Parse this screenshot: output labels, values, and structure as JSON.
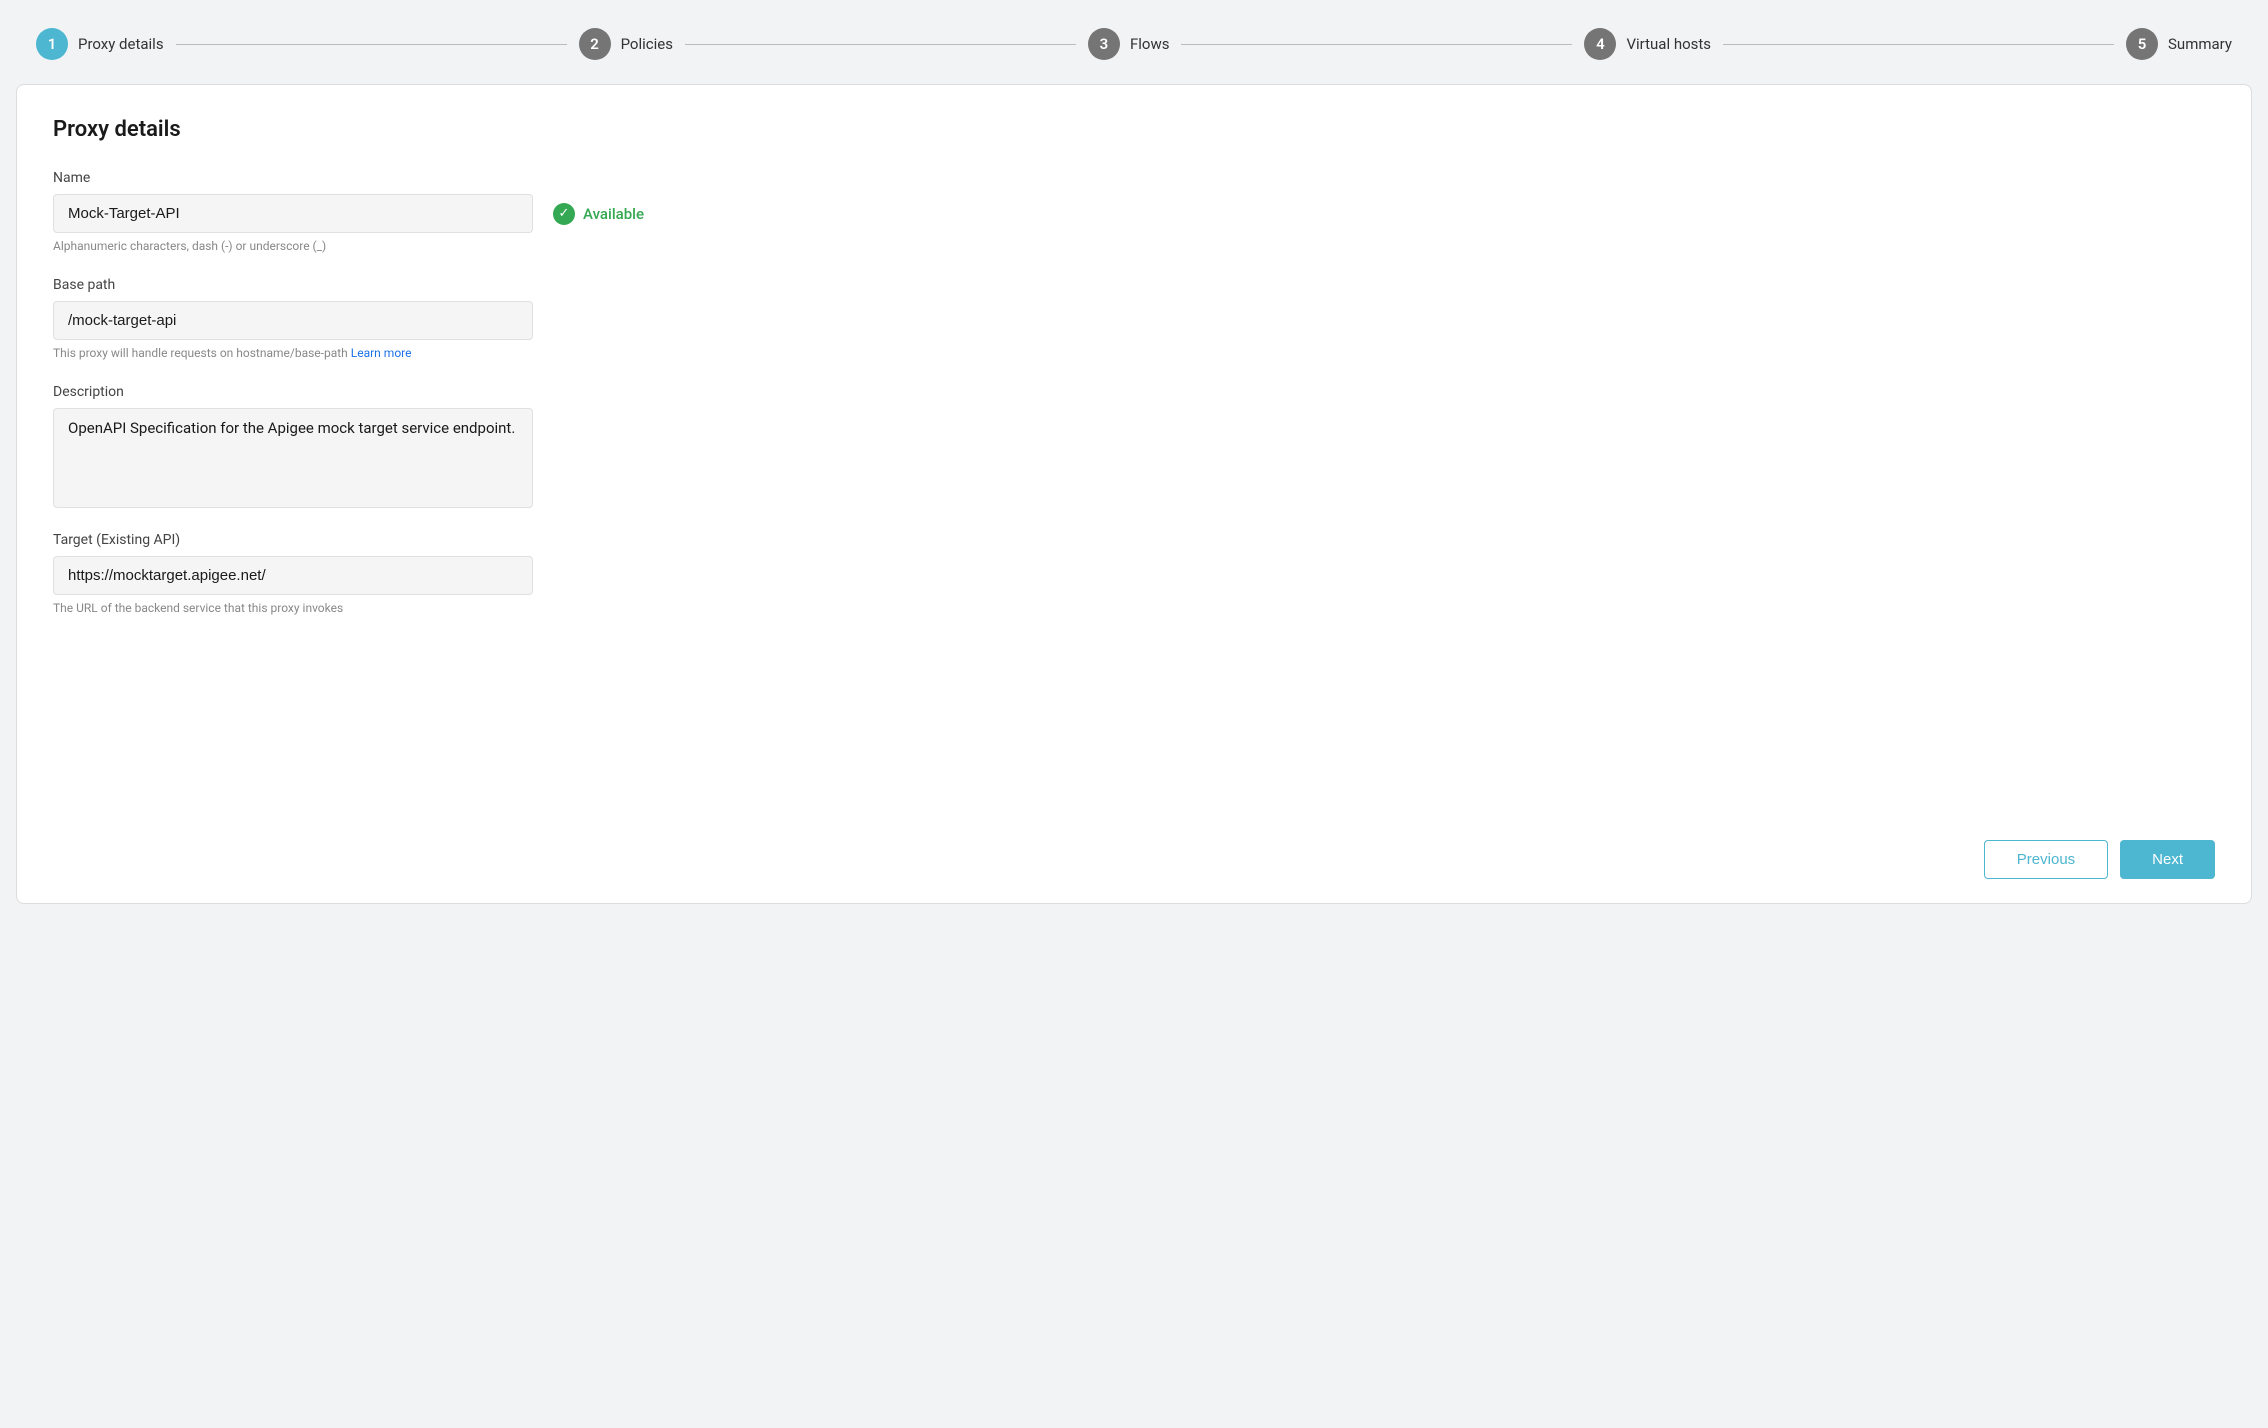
{
  "stepper": {
    "steps": [
      {
        "number": "1",
        "label": "Proxy details",
        "active": true
      },
      {
        "number": "2",
        "label": "Policies",
        "active": false
      },
      {
        "number": "3",
        "label": "Flows",
        "active": false
      },
      {
        "number": "4",
        "label": "Virtual hosts",
        "active": false
      },
      {
        "number": "5",
        "label": "Summary",
        "active": false
      }
    ]
  },
  "card": {
    "title": "Proxy details",
    "name_label": "Name",
    "name_value": "Mock-Target-API",
    "name_hint": "Alphanumeric characters, dash (-) or underscore (_)",
    "available_text": "Available",
    "basepath_label": "Base path",
    "basepath_value": "/mock-target-api",
    "basepath_hint": "This proxy will handle requests on hostname/base-path",
    "basepath_link_text": "Learn more",
    "basepath_link_url": "#",
    "description_label": "Description",
    "description_value": "OpenAPI Specification for the Apigee mock target service endpoint.",
    "target_label": "Target (Existing API)",
    "target_value": "https://mocktarget.apigee.net/",
    "target_hint": "The URL of the backend service that this proxy invokes",
    "btn_prev": "Previous",
    "btn_next": "Next"
  },
  "colors": {
    "active_step": "#4db6d0",
    "inactive_step": "#757575",
    "available": "#34a853",
    "link": "#1a73e8"
  }
}
